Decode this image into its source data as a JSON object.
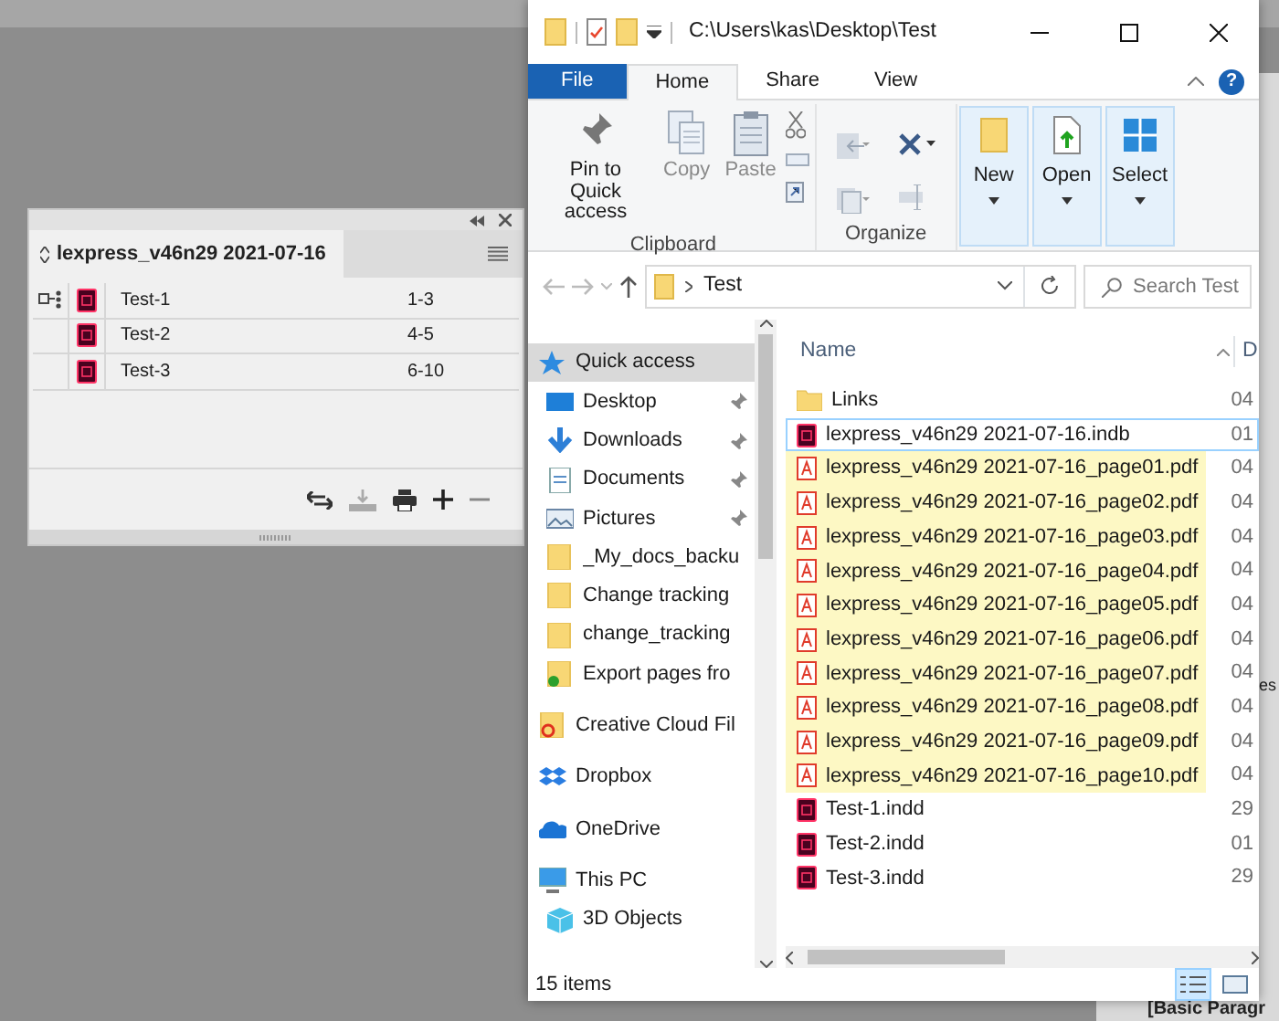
{
  "book_panel": {
    "title": "lexpress_v46n29 2021-07-16",
    "documents": [
      {
        "name": "Test-1",
        "pages": "1-3",
        "style_source": true
      },
      {
        "name": "Test-2",
        "pages": "4-5",
        "style_source": false
      },
      {
        "name": "Test-3",
        "pages": "6-10",
        "style_source": false
      }
    ]
  },
  "explorer": {
    "title": "C:\\Users\\kas\\Desktop\\Test",
    "ribbon_tabs": [
      {
        "label": "File",
        "kind": "file",
        "selected": false
      },
      {
        "label": "Home",
        "kind": "tab",
        "selected": true
      },
      {
        "label": "Share",
        "kind": "tab",
        "selected": false
      },
      {
        "label": "View",
        "kind": "tab",
        "selected": false
      }
    ],
    "clipboard": {
      "label": "Clipboard",
      "buttons": [
        {
          "label": "Pin to Quick access",
          "kind": "pin",
          "disabled": false
        },
        {
          "label": "Copy",
          "kind": "copy",
          "disabled": true
        },
        {
          "label": "Paste",
          "kind": "paste",
          "disabled": true
        }
      ]
    },
    "organize": {
      "label": "Organize"
    },
    "big_buttons": [
      {
        "label": "New",
        "kind": "new"
      },
      {
        "label": "Open",
        "kind": "open"
      },
      {
        "label": "Select",
        "kind": "select"
      }
    ],
    "address": "Test",
    "search": {
      "placeholder": "Search Test"
    },
    "nav": [
      {
        "label": "Quick access",
        "kind": "quick",
        "selected": true,
        "children": [
          {
            "label": "Desktop",
            "kind": "desktop",
            "pinned": true,
            "selected": false
          },
          {
            "label": "Downloads",
            "kind": "downloads",
            "pinned": true,
            "selected": false
          },
          {
            "label": "Documents",
            "kind": "documents",
            "pinned": true,
            "selected": false
          },
          {
            "label": "Pictures",
            "kind": "pictures",
            "pinned": true,
            "selected": false
          },
          {
            "label": "_My_docs_backu",
            "kind": "folder",
            "pinned": false,
            "selected": false
          },
          {
            "label": "Change tracking",
            "kind": "folder",
            "pinned": false,
            "selected": false
          },
          {
            "label": "change_tracking",
            "kind": "folder",
            "pinned": false,
            "selected": false
          },
          {
            "label": "Export pages fro",
            "kind": "synced",
            "pinned": false,
            "selected": false
          }
        ]
      },
      {
        "label": "Creative Cloud Fil",
        "kind": "cloudfolder",
        "selected": false
      },
      {
        "label": "Dropbox",
        "kind": "dropbox",
        "selected": false
      },
      {
        "label": "OneDrive",
        "kind": "onedrive",
        "selected": false
      },
      {
        "label": "This PC",
        "kind": "pc",
        "selected": false,
        "children": [
          {
            "label": "3D Objects",
            "kind": "objects",
            "pinned": false,
            "selected": false
          }
        ]
      }
    ],
    "columns": [
      "Name",
      "D"
    ],
    "files": [
      {
        "name": "Links",
        "kind": "folder",
        "date": "04",
        "highlighted": false,
        "focused": false
      },
      {
        "name": "lexpress_v46n29 2021-07-16.indb",
        "kind": "indd",
        "date": "01",
        "highlighted": false,
        "focused": true
      },
      {
        "name": "lexpress_v46n29 2021-07-16_page01.pdf",
        "kind": "pdf",
        "date": "04",
        "highlighted": true,
        "focused": false
      },
      {
        "name": "lexpress_v46n29 2021-07-16_page02.pdf",
        "kind": "pdf",
        "date": "04",
        "highlighted": true,
        "focused": false
      },
      {
        "name": "lexpress_v46n29 2021-07-16_page03.pdf",
        "kind": "pdf",
        "date": "04",
        "highlighted": true,
        "focused": false
      },
      {
        "name": "lexpress_v46n29 2021-07-16_page04.pdf",
        "kind": "pdf",
        "date": "04",
        "highlighted": true,
        "focused": false
      },
      {
        "name": "lexpress_v46n29 2021-07-16_page05.pdf",
        "kind": "pdf",
        "date": "04",
        "highlighted": true,
        "focused": false
      },
      {
        "name": "lexpress_v46n29 2021-07-16_page06.pdf",
        "kind": "pdf",
        "date": "04",
        "highlighted": true,
        "focused": false
      },
      {
        "name": "lexpress_v46n29 2021-07-16_page07.pdf",
        "kind": "pdf",
        "date": "04",
        "highlighted": true,
        "focused": false
      },
      {
        "name": "lexpress_v46n29 2021-07-16_page08.pdf",
        "kind": "pdf",
        "date": "04",
        "highlighted": true,
        "focused": false
      },
      {
        "name": "lexpress_v46n29 2021-07-16_page09.pdf",
        "kind": "pdf",
        "date": "04",
        "highlighted": true,
        "focused": false
      },
      {
        "name": "lexpress_v46n29 2021-07-16_page10.pdf",
        "kind": "pdf",
        "date": "04",
        "highlighted": true,
        "focused": false
      },
      {
        "name": "Test-1.indd",
        "kind": "indd",
        "date": "29",
        "highlighted": false,
        "focused": false
      },
      {
        "name": "Test-2.indd",
        "kind": "indd",
        "date": "01",
        "highlighted": false,
        "focused": false
      },
      {
        "name": "Test-3.indd",
        "kind": "indd",
        "date": "29",
        "highlighted": false,
        "focused": false
      }
    ],
    "status": "15 items",
    "view_buttons": [
      {
        "kind": "details",
        "selected": true
      },
      {
        "kind": "icons",
        "selected": false
      }
    ],
    "help": "?"
  },
  "background_window": {
    "texts": [
      "es",
      "[Basic Paragr"
    ]
  }
}
